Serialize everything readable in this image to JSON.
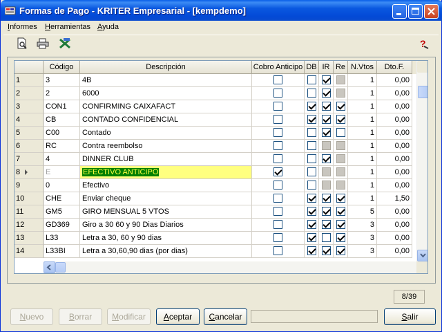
{
  "window": {
    "title": "Formas de Pago - KRITER Empresarial - [kempdemo]"
  },
  "menu": [
    {
      "label": "Informes",
      "key": "I",
      "rest": "nformes"
    },
    {
      "label": "Herramientas",
      "key": "H",
      "rest": "erramientas"
    },
    {
      "label": "Ayuda",
      "key": "A",
      "rest": "yuda"
    }
  ],
  "toolbar": {
    "icons": [
      "print-preview-icon",
      "printer-icon",
      "excel-export-icon",
      "help-icon"
    ]
  },
  "grid": {
    "columns": [
      "",
      "Código",
      "Descripción",
      "Cobro Anticipo",
      "DB",
      "IR",
      "Re",
      "N.Vtos",
      "Dto.F."
    ],
    "rows": [
      {
        "n": "1",
        "code": "3",
        "desc": "4B",
        "cobro": false,
        "db": false,
        "ir": true,
        "re": "dis",
        "vtos": "1",
        "dto": "0,00"
      },
      {
        "n": "2",
        "code": "2",
        "desc": "6000",
        "cobro": false,
        "db": false,
        "ir": true,
        "re": "dis",
        "vtos": "1",
        "dto": "0,00"
      },
      {
        "n": "3",
        "code": "CON1",
        "desc": "CONFIRMING CAIXAFACT",
        "cobro": false,
        "db": true,
        "ir": true,
        "re": true,
        "vtos": "1",
        "dto": "0,00"
      },
      {
        "n": "4",
        "code": "CB",
        "desc": "CONTADO CONFIDENCIAL",
        "cobro": false,
        "db": true,
        "ir": true,
        "re": true,
        "vtos": "1",
        "dto": "0,00"
      },
      {
        "n": "5",
        "code": "C00",
        "desc": "Contado",
        "cobro": false,
        "db": false,
        "ir": true,
        "re": false,
        "vtos": "1",
        "dto": "0,00"
      },
      {
        "n": "6",
        "code": "RC",
        "desc": "Contra reembolso",
        "cobro": false,
        "db": false,
        "ir": "dis",
        "re": "dis",
        "vtos": "1",
        "dto": "0,00"
      },
      {
        "n": "7",
        "code": "4",
        "desc": "DINNER CLUB",
        "cobro": false,
        "db": false,
        "ir": true,
        "re": "dis",
        "vtos": "1",
        "dto": "0,00"
      },
      {
        "n": "8",
        "code": "E",
        "desc": "EFECTIVO ANTICIPO",
        "cobro": true,
        "db": false,
        "ir": "dis",
        "re": "dis",
        "vtos": "1",
        "dto": "0,00",
        "selected": true
      },
      {
        "n": "9",
        "code": "0",
        "desc": "Efectivo",
        "cobro": false,
        "db": false,
        "ir": "dis",
        "re": "dis",
        "vtos": "1",
        "dto": "0,00"
      },
      {
        "n": "10",
        "code": "CHE",
        "desc": "Enviar cheque",
        "cobro": false,
        "db": true,
        "ir": true,
        "re": true,
        "vtos": "1",
        "dto": "1,50"
      },
      {
        "n": "11",
        "code": "GM5",
        "desc": "GIRO MENSUAL 5 VTOS",
        "cobro": false,
        "db": true,
        "ir": true,
        "re": true,
        "vtos": "5",
        "dto": "0,00"
      },
      {
        "n": "12",
        "code": "GD369",
        "desc": "Giro a 30 60 y 90 Dias Diarios",
        "cobro": false,
        "db": true,
        "ir": true,
        "re": true,
        "vtos": "3",
        "dto": "0,00"
      },
      {
        "n": "13",
        "code": "L33",
        "desc": "Letra a 30, 60 y 90 dias",
        "cobro": false,
        "db": true,
        "ir": false,
        "re": true,
        "vtos": "3",
        "dto": "0,00"
      },
      {
        "n": "14",
        "code": "L33BI",
        "desc": "Letra a 30,60,90 dias (por dias)",
        "cobro": false,
        "db": true,
        "ir": true,
        "re": true,
        "vtos": "3",
        "dto": "0,00"
      }
    ]
  },
  "status": {
    "counter": "8/39"
  },
  "buttons": {
    "nuevo": {
      "key": "N",
      "rest": "uevo"
    },
    "borrar": {
      "key": "B",
      "rest": "orrar"
    },
    "modificar": {
      "key": "M",
      "rest": "odificar"
    },
    "aceptar": {
      "key": "A",
      "rest": "ceptar"
    },
    "cancelar": {
      "key": "C",
      "rest": "ancelar"
    },
    "salir": {
      "key": "S",
      "rest": "alir"
    }
  }
}
